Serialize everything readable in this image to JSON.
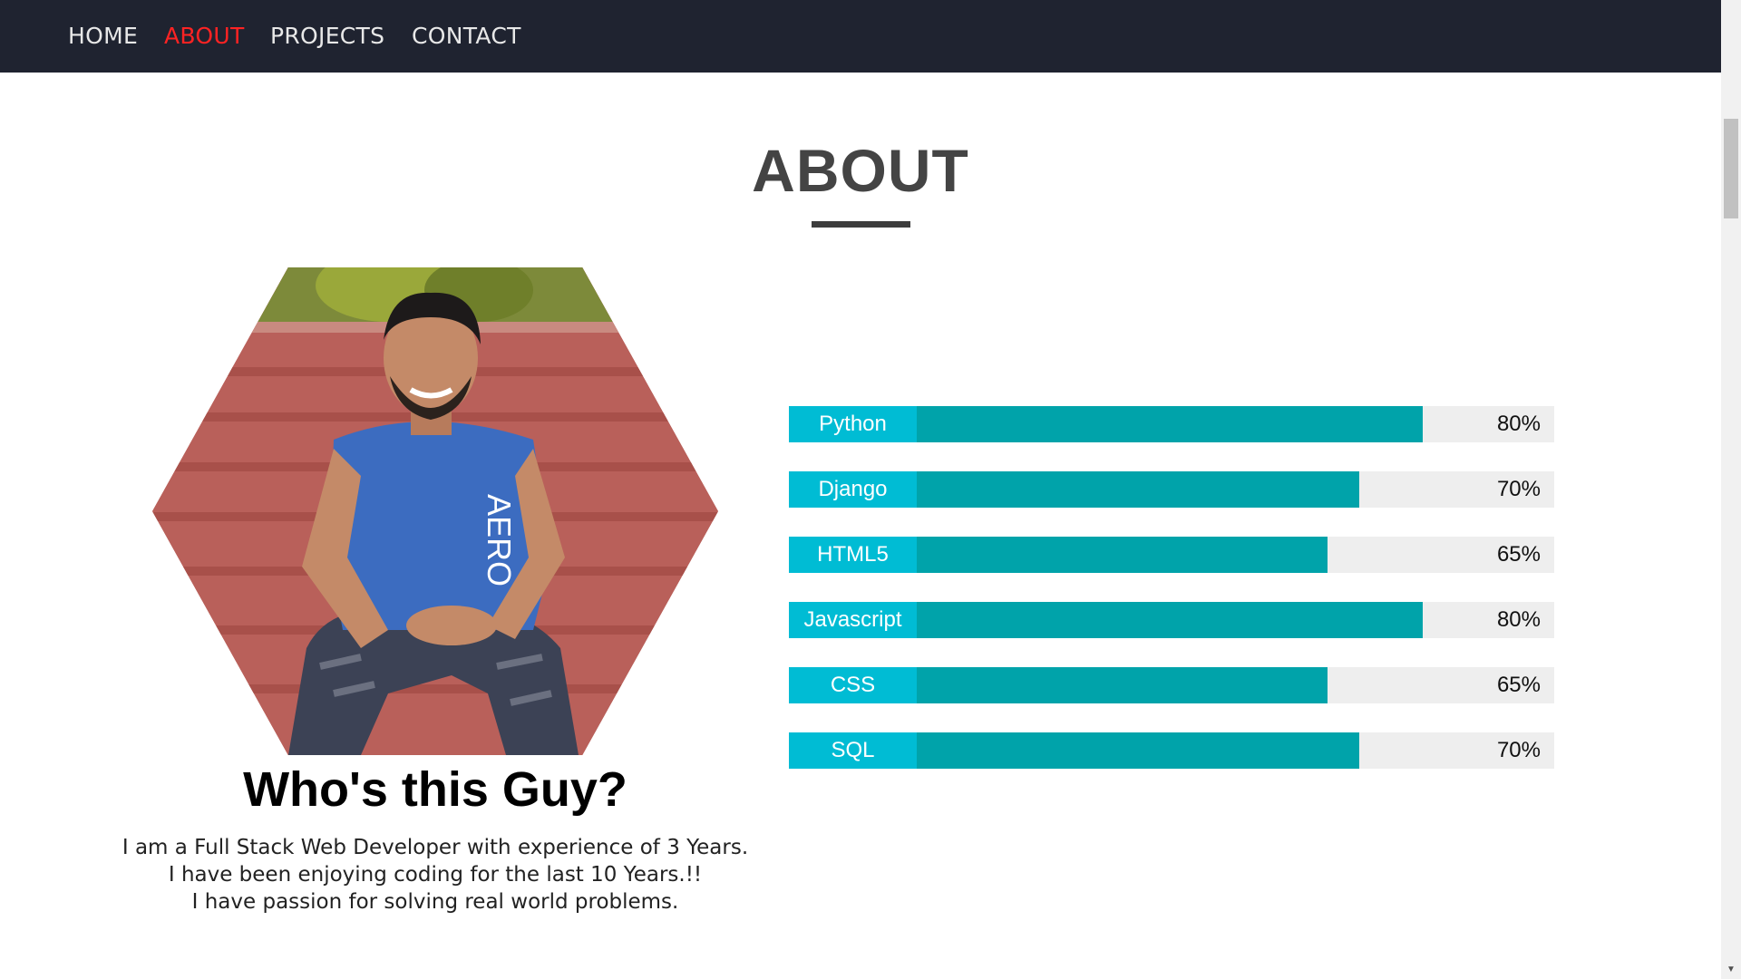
{
  "nav": {
    "items": [
      {
        "label": "HOME"
      },
      {
        "label": "ABOUT",
        "active": true
      },
      {
        "label": "PROJECTS"
      },
      {
        "label": "CONTACT"
      }
    ],
    "active_color": "#ff2323",
    "background_color": "#1f2330"
  },
  "about": {
    "title": "ABOUT",
    "heading": "Who's this Guy?",
    "bio": [
      "I am a Full Stack Web Developer with experience of 3 Years.",
      "I have been enjoying coding for the last 10 Years.!!",
      "I have passion for solving real world problems."
    ],
    "photo_icon": "profile-photo"
  },
  "skills": [
    {
      "label": "Python",
      "percent_text": "80%",
      "level": 80
    },
    {
      "label": "Django",
      "percent_text": "70%",
      "level": 70
    },
    {
      "label": "HTML5",
      "percent_text": "65%",
      "level": 65
    },
    {
      "label": "Javascript",
      "percent_text": "80%",
      "level": 80
    },
    {
      "label": "CSS",
      "percent_text": "65%",
      "level": 65
    },
    {
      "label": "SQL",
      "percent_text": "70%",
      "level": 70
    }
  ],
  "colors": {
    "skill_label_bg": "#00bcd4",
    "skill_fill": "#00a3aa",
    "skill_track": "#eeeeee"
  }
}
